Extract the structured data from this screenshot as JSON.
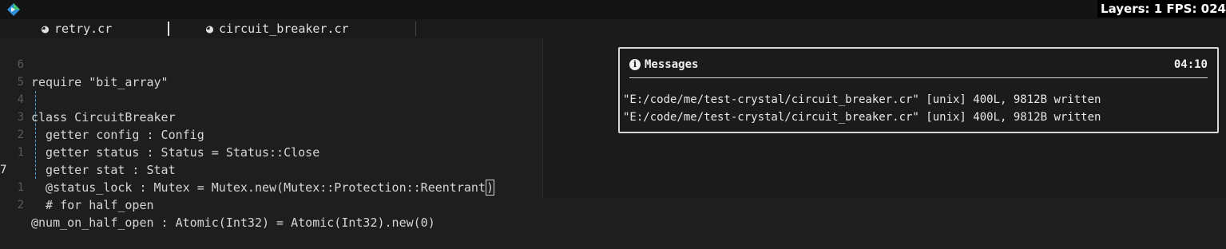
{
  "overlay": {
    "stats": "Layers: 1 FPS: 024"
  },
  "tabs": [
    {
      "icon": "crystal-file-icon",
      "icon_glyph": "◕",
      "label": "retry.cr"
    },
    {
      "icon": "crystal-file-icon",
      "icon_glyph": "◕",
      "label": "circuit_breaker.cr"
    }
  ],
  "editor": {
    "lines": [
      {
        "num": "6",
        "text": "require \"bit_array\""
      },
      {
        "num": "5",
        "text": ""
      },
      {
        "num": "4",
        "text": "class CircuitBreaker"
      },
      {
        "num": "3",
        "text": "  getter config : Config"
      },
      {
        "num": "2",
        "text": "  getter status : Status = Status::Close"
      },
      {
        "num": "1",
        "text": "  getter stat : Stat"
      },
      {
        "num": "7",
        "text": "  @status_lock : Mutex = Mutex.new(Mutex::Protection::Reentrant",
        "cursor_char": ")"
      },
      {
        "num": "1",
        "text": "  # for half_open"
      },
      {
        "num": "2",
        "text": "@num_on_half_open : Atomic(Int32) = Atomic(Int32).new(0)"
      }
    ]
  },
  "messages": {
    "title": "Messages",
    "time": "04:10",
    "icon": "info-icon",
    "icon_glyph": "i",
    "items": [
      "\"E:/code/me/test-crystal/circuit_breaker.cr\" [unix] 400L, 9812B written",
      "\"E:/code/me/test-crystal/circuit_breaker.cr\" [unix] 400L, 9812B written"
    ]
  },
  "colors": {
    "background": "#1e1e1e",
    "indent_guide": "#4aa3df",
    "panel_border": "#d8d8d8",
    "logo_green": "#3ec46d",
    "logo_blue": "#2f8fd8"
  }
}
